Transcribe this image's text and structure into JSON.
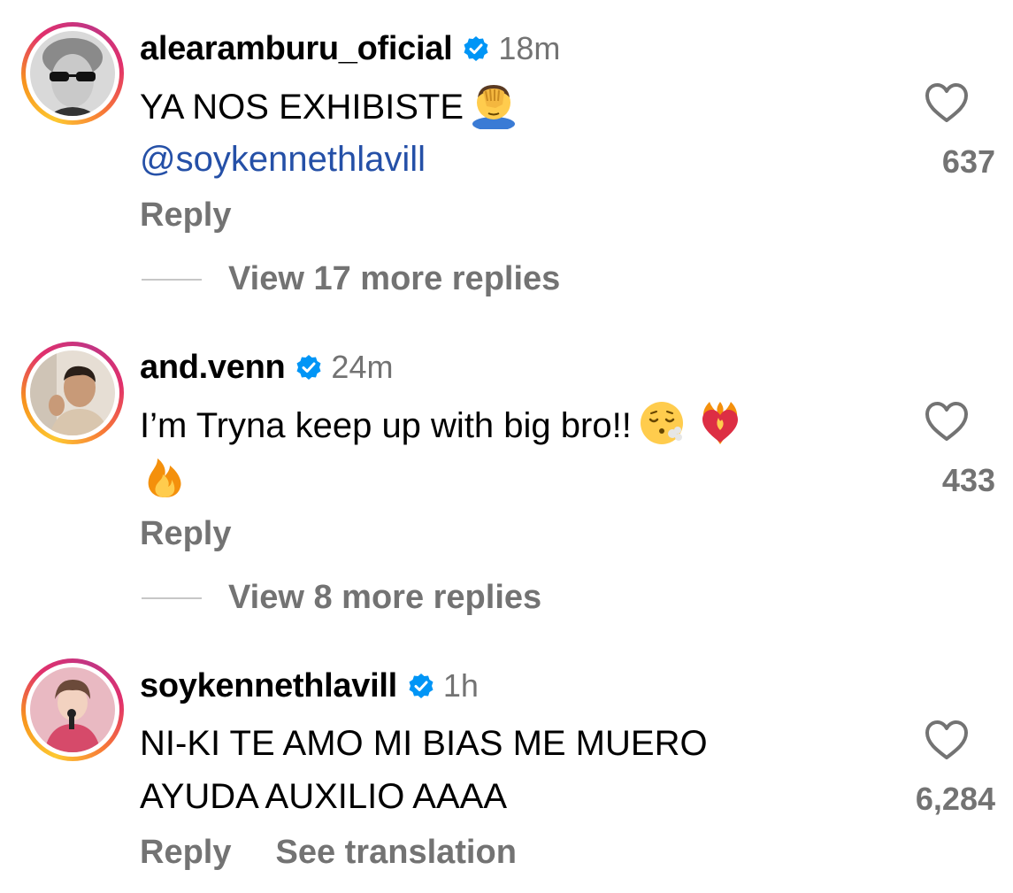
{
  "comments": [
    {
      "username": "alearamburu_oficial",
      "time": "18m",
      "lines": [
        "YA NOS EXHIBISTE",
        "@soykennethlavill"
      ],
      "likes": "637",
      "reply_label": "Reply",
      "more_replies": "View 17 more replies",
      "emojis": [
        "facepalm-emoji"
      ]
    },
    {
      "username": "and.venn",
      "time": "24m",
      "lines": [
        "I’m Tryna keep up with big bro!!",
        ""
      ],
      "likes": "433",
      "reply_label": "Reply",
      "more_replies": "View 8 more replies",
      "emojis": [
        "exhale-face-emoji",
        "heart-on-fire-emoji",
        "fire-emoji"
      ]
    },
    {
      "username": "soykennethlavill",
      "time": "1h",
      "lines": [
        "NI-KI TE AMO MI BIAS ME MUERO",
        "AYUDA AUXILIO AAAA"
      ],
      "likes": "6,284",
      "reply_label": "Reply",
      "translate_label": "See translation"
    }
  ],
  "colors": {
    "text": "#000000",
    "secondary": "#737373",
    "mention": "#2550a7",
    "verified": "#0095f6"
  }
}
